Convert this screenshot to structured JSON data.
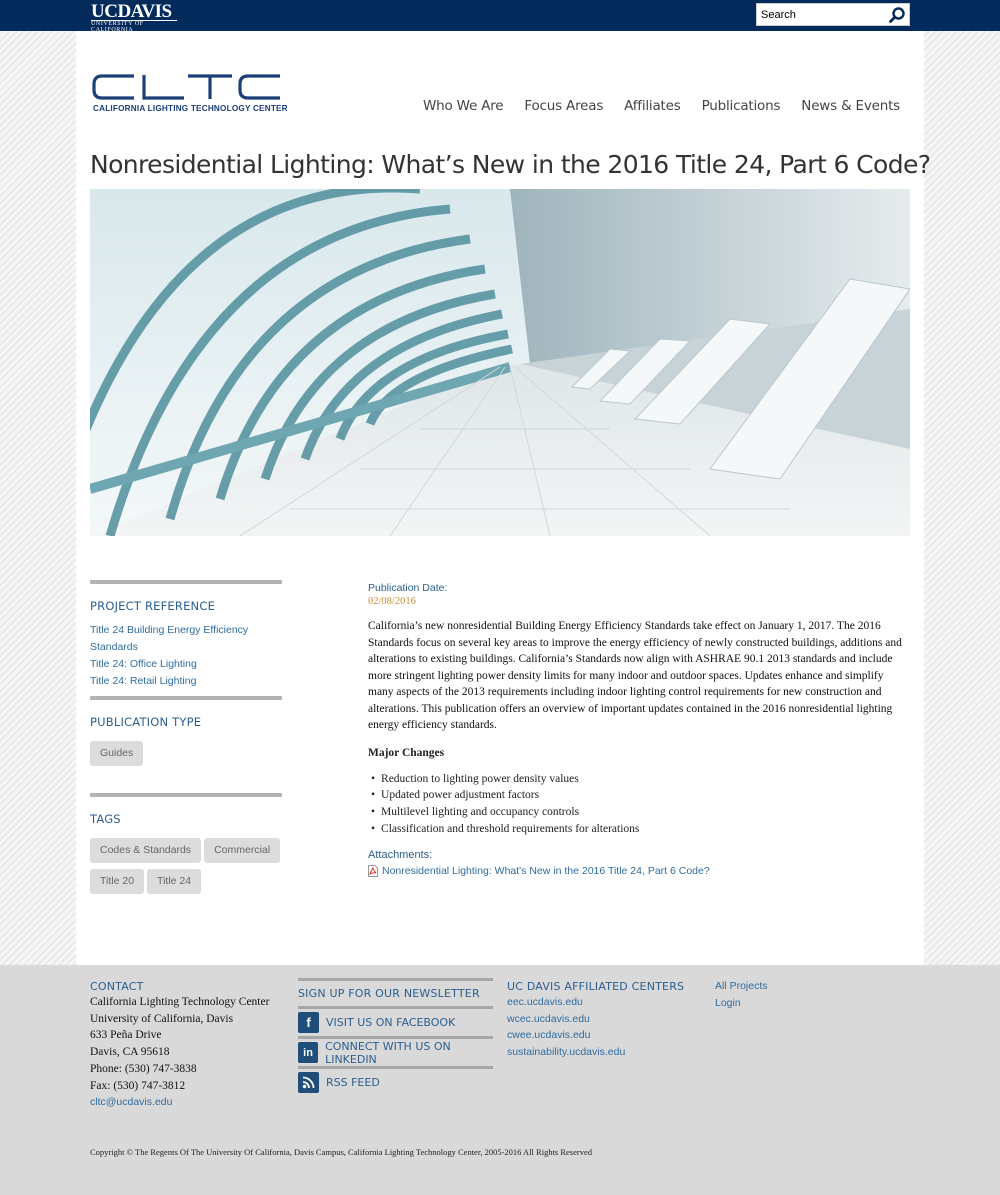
{
  "topbar": {
    "logo_main_bold": "UC",
    "logo_main_rest": "DAVIS",
    "logo_sub": "UNIVERSITY OF CALIFORNIA",
    "search_placeholder": "Search"
  },
  "header": {
    "logo_subtitle": "CALIFORNIA LIGHTING TECHNOLOGY CENTER",
    "nav": [
      "Who We Are",
      "Focus Areas",
      "Affiliates",
      "Publications",
      "News & Events"
    ]
  },
  "page": {
    "title": "Nonresidential Lighting: What’s New in the 2016 Title 24, Part 6 Code?"
  },
  "sidebar": {
    "project_reference": {
      "heading": "PROJECT REFERENCE",
      "links": [
        "Title 24 Building Energy Efficiency Standards",
        "Title 24: Office Lighting",
        "Title 24: Retail Lighting"
      ]
    },
    "publication_type": {
      "heading": "PUBLICATION TYPE",
      "tags": [
        "Guides"
      ]
    },
    "tags": {
      "heading": "TAGS",
      "tags": [
        "Codes & Standards",
        "Commercial",
        "Title 20",
        "Title 24"
      ]
    }
  },
  "content": {
    "pub_date_label": "Publication Date:",
    "pub_date": "02/08/2016",
    "body": "California’s new nonresidential Building Energy Efficiency Standards take effect on January 1, 2017. The 2016 Standards focus on several key areas to improve the energy efficiency of newly constructed buildings, additions and alterations to existing buildings. California’s Standards now align with ASHRAE 90.1 2013 standards and include more stringent lighting power density limits for many indoor and outdoor spaces. Updates enhance and simplify many aspects of the 2013 requirements including indoor lighting control requirements for new construction and alterations. This publication offers an overview of important updates contained in the 2016 nonresidential lighting energy efficiency standards.",
    "major_changes_heading": "Major Changes",
    "major_changes": [
      "Reduction to lighting power density values",
      "Updated power adjustment factors",
      "Multilevel lighting and occupancy controls",
      "Classification and threshold requirements for alterations"
    ],
    "attachments_label": "Attachments:",
    "attachment_link": "Nonresidential Lighting: What's New in the 2016 Title 24, Part 6 Code?"
  },
  "footer": {
    "contact_heading": "CONTACT",
    "contact_lines": [
      "California Lighting Technology Center",
      "University of California, Davis",
      "633 Peña Drive",
      "Davis, CA 95618",
      "Phone: (530) 747-3838",
      "Fax: (530) 747-3812"
    ],
    "contact_email": "cltc@ucdavis.edu",
    "newsletter_heading": "SIGN UP FOR OUR NEWSLETTER",
    "facebook": "VISIT US ON FACEBOOK",
    "linkedin": "CONNECT WITH US ON LINKEDIN",
    "rss": "RSS FEED",
    "centers_heading": "UC DAVIS AFFILIATED CENTERS",
    "centers": [
      "eec.ucdavis.edu",
      "wcec.ucdavis.edu",
      "cwee.ucdavis.edu",
      "sustainability.ucdavis.edu"
    ],
    "links": [
      "All Projects",
      "Login"
    ],
    "copyright": "Copyright © The Regents Of The University Of California, Davis Campus, California Lighting Technology Center, 2005-2016 All Rights Reserved"
  },
  "colors": {
    "topbar": "#022b5c",
    "accent_blue": "#2b5e8e",
    "date_orange": "#d28a3c",
    "footer_bg": "#d9d9d9"
  }
}
